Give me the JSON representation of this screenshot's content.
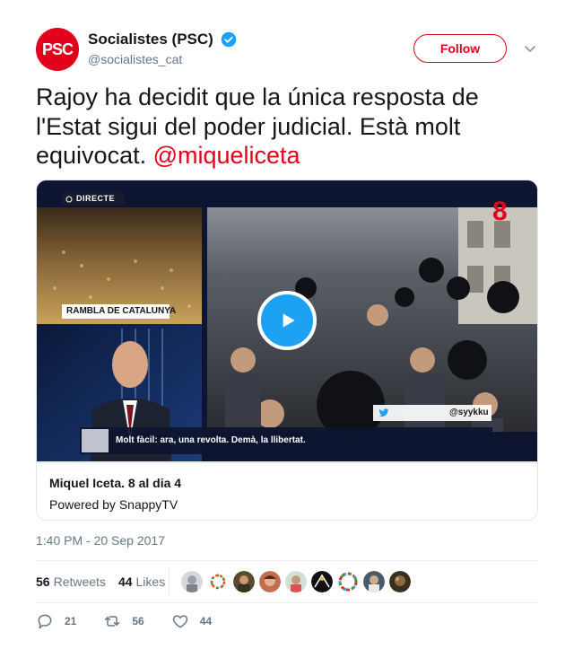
{
  "author": {
    "name": "Socialistes (PSC)",
    "handle": "@socialistes_cat",
    "avatar_text": "PSC",
    "verified": true,
    "brand_color": "#e2001a"
  },
  "follow_label": "Follow",
  "tweet": {
    "text": "Rajoy ha decidit que la única resposta de l'Estat sigui del poder judicial. Està molt equivocat. ",
    "mention": "@miqueliceta"
  },
  "video": {
    "live_badge": "DIRECTE",
    "location_tag": "RAMBLA DE CATALUNYA",
    "channel_mark": "8",
    "source_handle": "@syykku",
    "subtitle": "Molt fàcil: ara, una revolta. Demà, la llibertat."
  },
  "card": {
    "title": "Miquel Iceta. 8 al dia 4",
    "subtitle": "Powered by SnappyTV"
  },
  "timestamp": "1:40 PM - 20 Sep 2017",
  "stats": {
    "retweets_count": "56",
    "retweets_label": "Retweets",
    "likes_count": "44",
    "likes_label": "Likes"
  },
  "actions": {
    "reply_count": "21",
    "retweet_count": "56",
    "like_count": "44"
  },
  "icons": [
    "verified-icon",
    "chevron-down-icon",
    "play-icon",
    "reply-icon",
    "retweet-icon",
    "heart-icon",
    "twitter-bird-icon"
  ]
}
